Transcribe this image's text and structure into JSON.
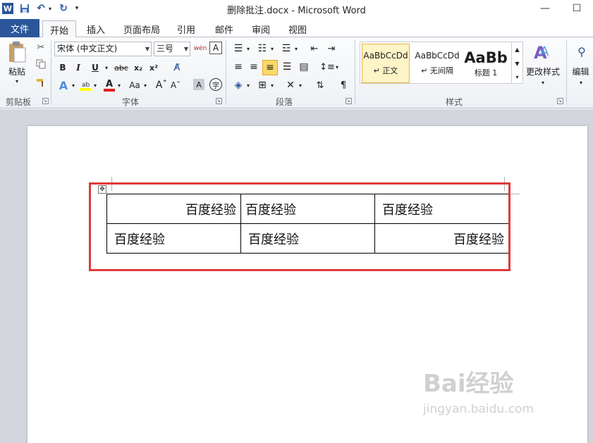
{
  "window": {
    "title": "删除批注.docx - Microsoft Word"
  },
  "tabs": {
    "file": "文件",
    "items": [
      "开始",
      "插入",
      "页面布局",
      "引用",
      "邮件",
      "审阅",
      "视图"
    ]
  },
  "ribbon": {
    "clipboard": {
      "paste_label": "粘贴",
      "group_label": "剪贴板"
    },
    "font": {
      "font_name": "宋体 (中文正文)",
      "font_size": "三号",
      "group_label": "字体",
      "bold": "B",
      "italic": "I",
      "underline": "U",
      "strike": "abc",
      "subscript": "x₂",
      "superscript": "x²",
      "font_color": "A",
      "case": "Aa"
    },
    "paragraph": {
      "group_label": "段落"
    },
    "styles": {
      "group_label": "样式",
      "tiles": [
        {
          "preview": "AaBbCcDd",
          "name": "↵ 正文"
        },
        {
          "preview": "AaBbCcDd",
          "name": "↵ 无间隔"
        },
        {
          "preview": "AaBb",
          "name": "标题 1"
        }
      ],
      "change_styles": "更改样式"
    },
    "editing": {
      "label": "编辑"
    }
  },
  "document": {
    "table": {
      "rows": [
        [
          "百度经验",
          "百度经验",
          "百度经验"
        ],
        [
          "百度经验",
          "百度经验",
          "百度经验"
        ]
      ]
    }
  },
  "watermark": {
    "brand": "Bai经验",
    "url": "jingyan.baidu.com"
  },
  "colors": {
    "file_tab": "#2b579a",
    "highlight": "#e03a3a",
    "selected_style": "#fdf4c8"
  }
}
